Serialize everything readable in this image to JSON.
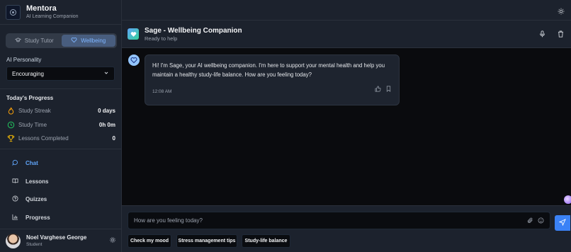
{
  "app": {
    "name": "Mentora",
    "tagline": "AI Learning Companion"
  },
  "mode_toggle": {
    "options": [
      "Study Tutor",
      "Wellbeing"
    ],
    "active": "Wellbeing"
  },
  "personality": {
    "label": "AI Personality",
    "selected": "Encouraging"
  },
  "progress": {
    "title": "Today's Progress",
    "items": [
      {
        "label": "Study Streak",
        "value": "0 days",
        "icon": "flame-icon"
      },
      {
        "label": "Study Time",
        "value": "0h 0m",
        "icon": "clock-icon"
      },
      {
        "label": "Lessons Completed",
        "value": "0",
        "icon": "trophy-icon"
      }
    ]
  },
  "nav": [
    {
      "label": "Chat",
      "icon": "chat-bubble-icon",
      "active": true
    },
    {
      "label": "Lessons",
      "icon": "book-icon",
      "active": false
    },
    {
      "label": "Quizzes",
      "icon": "help-circle-icon",
      "active": false
    },
    {
      "label": "Progress",
      "icon": "bar-chart-icon",
      "active": false
    }
  ],
  "user": {
    "name": "Noel Varghese George",
    "role": "Student"
  },
  "chat_header": {
    "title": "Sage - Wellbeing Companion",
    "status": "Ready to help"
  },
  "messages": [
    {
      "sender": "assistant",
      "text": "Hi! I'm Sage, your AI wellbeing companion. I'm here to support your mental health and help you maintain a healthy study-life balance. How are you feeling today?",
      "time": "12:08 AM"
    }
  ],
  "composer": {
    "placeholder": "How are you feeling today?",
    "value": ""
  },
  "quick_replies": [
    "Check my mood",
    "Stress management tips",
    "Study-life balance"
  ],
  "colors": {
    "accent": "#3b82f6",
    "active_nav": "#60a5fa",
    "sidebar_bg": "#1c222d",
    "chat_bg": "#0a0b0e"
  }
}
